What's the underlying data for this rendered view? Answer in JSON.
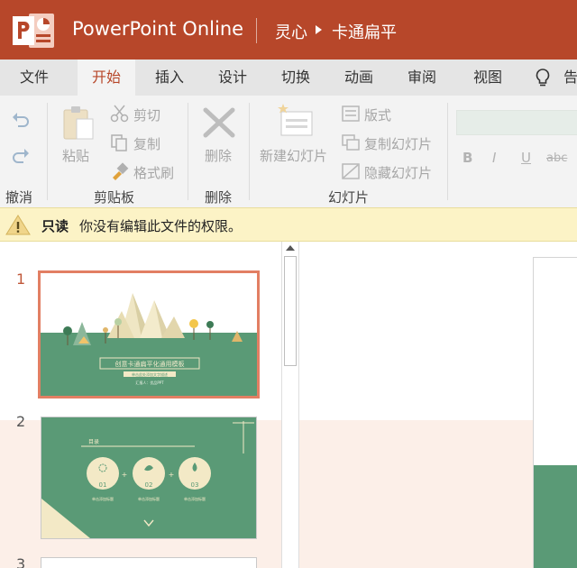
{
  "app": {
    "name": "PowerPoint Online",
    "logo_icon": "powerpoint-logo-icon",
    "brand_color": "#b7472a"
  },
  "breadcrumb": {
    "folder": "灵心",
    "file": "卡通扁平"
  },
  "tabs": [
    {
      "label": "文件",
      "active": false
    },
    {
      "label": "开始",
      "active": true
    },
    {
      "label": "插入",
      "active": false
    },
    {
      "label": "设计",
      "active": false
    },
    {
      "label": "切换",
      "active": false
    },
    {
      "label": "动画",
      "active": false
    },
    {
      "label": "审阅",
      "active": false
    },
    {
      "label": "视图",
      "active": false
    },
    {
      "label": "告",
      "active": false,
      "icon": "lightbulb-icon"
    }
  ],
  "ribbon": {
    "undo_group": "撤消",
    "clipboard": {
      "paste": "粘贴",
      "cut": "剪切",
      "copy": "复制",
      "format_painter": "格式刷",
      "group": "剪贴板"
    },
    "delete": {
      "button": "删除",
      "group": "删除"
    },
    "slides": {
      "new_slide": "新建幻灯片",
      "layout": "版式",
      "duplicate": "复制幻灯片",
      "hide": "隐藏幻灯片",
      "group": "幻灯片"
    },
    "font": {
      "bold": "B",
      "italic": "I",
      "underline": "U",
      "strike": "abc"
    }
  },
  "infobar": {
    "bold": "只读",
    "message": "你没有编辑此文件的权限。",
    "icon": "warning-icon",
    "bg_color": "#fcf3c6"
  },
  "thumbnails": {
    "numbers": [
      "1",
      "2",
      "3"
    ],
    "selected_border_color": "#e27f63",
    "slide1": {
      "title": "创意卡通扁平化通用模板",
      "subtitle": "单击此处添加文字描述",
      "author": "汇报人：优品PPT"
    },
    "slide2": {
      "header": "目录",
      "items": [
        "01",
        "02",
        "03"
      ],
      "caption": "单击添加标题"
    }
  },
  "colors": {
    "slide_green": "#5a9a76",
    "slide_cream": "#f3e9c6"
  }
}
